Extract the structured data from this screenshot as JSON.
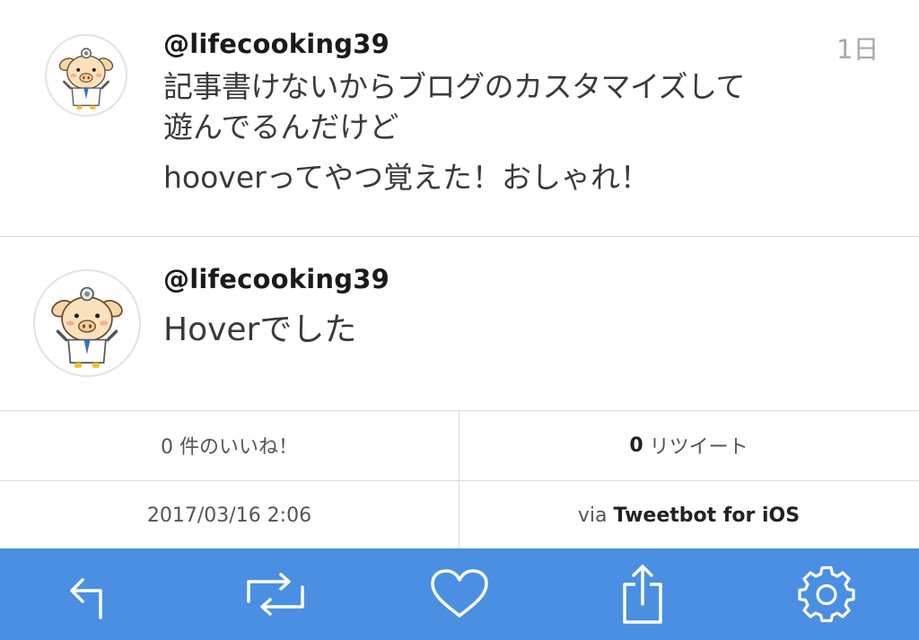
{
  "tweets": [
    {
      "handle": "@lifecooking39",
      "time": "1日",
      "lines": [
        "記事書けないからブログのカスタマイズして",
        "遊んでるんだけど",
        "hooverってやつ覚えた！おしゃれ！"
      ]
    },
    {
      "handle": "@lifecooking39",
      "lines": [
        "Hoverでした"
      ]
    }
  ],
  "stats": {
    "likes": "0 件のいいね！",
    "retweets_count": "0",
    "retweets_label": " リツイート",
    "datetime": "2017/03/16 2:06",
    "via_prefix": "via ",
    "client": "Tweetbot for iOS"
  },
  "toolbar": {
    "background": "#4a8fe2",
    "icons": [
      "reply-icon",
      "retweet-icon",
      "heart-icon",
      "share-icon",
      "gear-icon"
    ]
  }
}
